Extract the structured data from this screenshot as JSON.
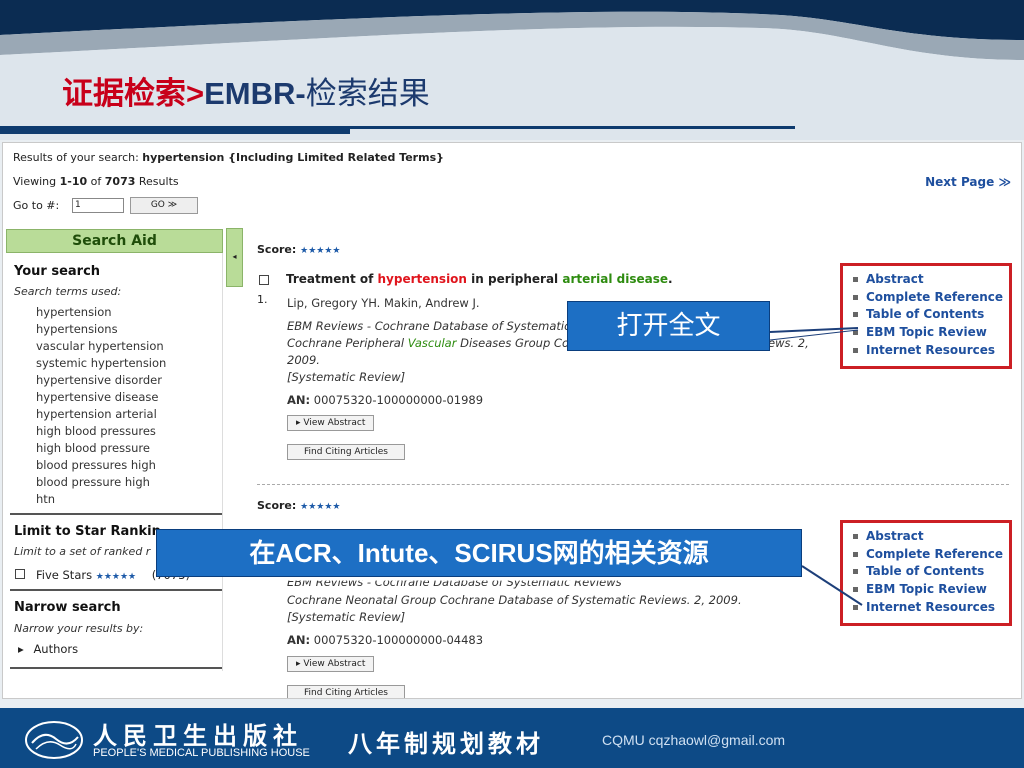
{
  "slide": {
    "title_zh": "证据检索",
    "title_sep": ">",
    "title_en": "EMBR-",
    "title_zh2": "检索结果"
  },
  "results_header": {
    "search_prefix": "Results of your search:",
    "search_term": "hypertension {Including Limited Related Terms}",
    "viewing_prefix": "Viewing",
    "viewing_range": "1-10",
    "viewing_of": "of",
    "viewing_total": "7073",
    "viewing_suffix": "Results",
    "goto_label": "Go to #:",
    "goto_value": "1",
    "go_button": "GO ≫",
    "next_page": "Next Page ≫"
  },
  "sidebar": {
    "title": "Search Aid",
    "collapse_arrow": "◂",
    "your_search": "Your search",
    "terms_label": "Search terms used:",
    "terms": [
      "hypertension",
      "hypertensions",
      "vascular hypertension",
      "systemic hypertension",
      "hypertensive disorder",
      "hypertensive disease",
      "hypertension arterial",
      "high blood pressures",
      "high blood pressure",
      "blood pressures high",
      "blood pressure high",
      "htn"
    ],
    "limit_title": "Limit to Star Rankin",
    "limit_desc": "Limit to a set of ranked r",
    "five_stars": "Five Stars",
    "stars": "★★★★★",
    "five_stars_count_tail": "(7073)",
    "narrow_title": "Narrow search",
    "narrow_desc": "Narrow your results by:",
    "authors": "Authors",
    "authors_arrow": "▸"
  },
  "results": [
    {
      "score_label": "Score:",
      "stars": "★★★★★",
      "num": "1.",
      "title_parts": [
        "Treatment of ",
        "hypertension",
        " in peripheral ",
        "arterial disease",
        "."
      ],
      "authors": "Lip, Gregory YH. Makin, Andrew J.",
      "source_l1": "EBM Reviews - Cochrane Database of Systematic",
      "source_l1_tail": "ews. 2,",
      "source_l2_a": "Cochrane Peripheral ",
      "source_l2_b": "Vascular",
      "source_l2_c": " Diseases Group Co",
      "source_l3": "2009.",
      "type": "[Systematic Review]",
      "an_label": "AN:",
      "an_value": "00075320-100000000-01989",
      "view_abstract": "▸ View Abstract",
      "find_citing": "Find Citing Articles"
    },
    {
      "score_label": "Score:",
      "stars": "★★★★★",
      "source_l1": "EBM Reviews - Cochrane Database of Systematic Reviews",
      "source_l2": "Cochrane Neonatal Group Cochrane Database of Systematic Reviews. 2, 2009.",
      "type": "[Systematic Review]",
      "an_label": "AN:",
      "an_value": "00075320-100000000-04483",
      "view_abstract": "▸ View Abstract",
      "find_citing": "Find Citing Articles"
    }
  ],
  "link_lists": [
    [
      "Abstract",
      "Complete Reference",
      "Table of Contents",
      "EBM Topic Review",
      "Internet Resources"
    ],
    [
      "Abstract",
      "Complete Reference",
      "Table of Contents",
      "EBM Topic Review",
      "Internet Resources"
    ]
  ],
  "callouts": {
    "fulltext": "打开全文",
    "resources": "在ACR、Intute、SCIRUS网的相关资源"
  },
  "footer": {
    "publisher_cn": "人民卫生出版社",
    "publisher_en": "PEOPLE'S MEDICAL PUBLISHING HOUSE",
    "series": "八年制规划教材",
    "credit": "CQMU cqzhaowl@gmail.com"
  },
  "colors": {
    "title_red": "#c8001a",
    "title_navy": "#1c3a6e",
    "link_blue": "#1e4f9e",
    "highlight_red": "#e0151d",
    "highlight_green": "#2e8c10",
    "callout_blue": "#1d6fc4",
    "box_red": "#cc1f24",
    "footer_navy": "#0d4a86",
    "aid_green": "#b9dc98"
  }
}
